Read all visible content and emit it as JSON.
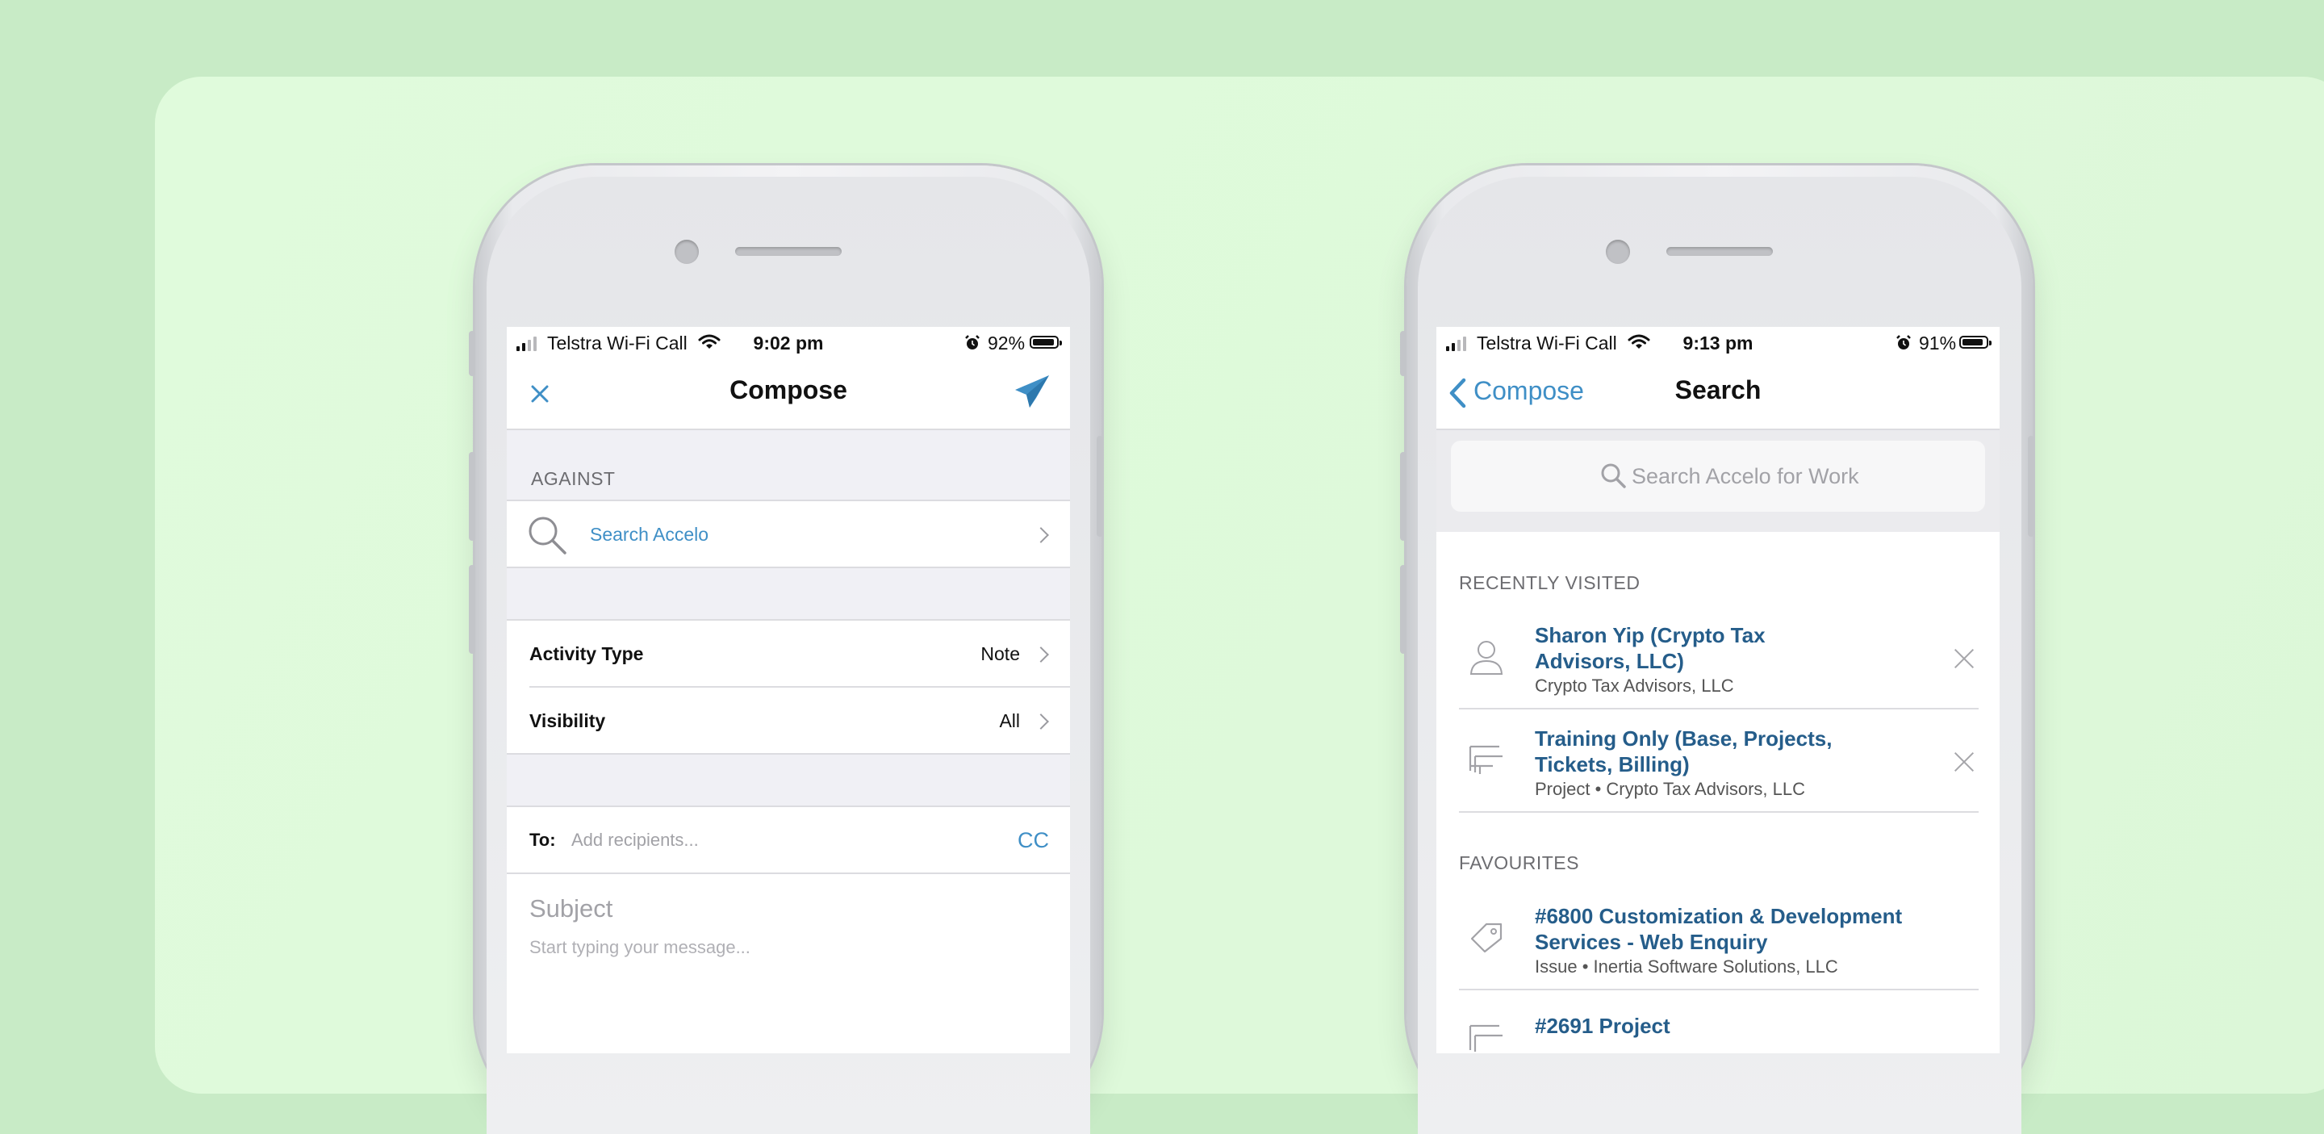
{
  "left_phone": {
    "status": {
      "carrier": "Telstra Wi-Fi Call",
      "time": "9:02 pm",
      "battery": "92%",
      "battery_level": 0.92
    },
    "nav": {
      "title": "Compose",
      "close_icon": "close-icon",
      "send_icon": "send-icon"
    },
    "against": {
      "label": "AGAINST",
      "search_text": "Search Accelo"
    },
    "activity_type": {
      "label": "Activity Type",
      "value": "Note"
    },
    "visibility": {
      "label": "Visibility",
      "value": "All"
    },
    "to": {
      "label": "To:",
      "placeholder": "Add recipients...",
      "cc": "CC"
    },
    "subject": {
      "placeholder": "Subject"
    },
    "message": {
      "placeholder": "Start typing your message..."
    }
  },
  "right_phone": {
    "status": {
      "carrier": "Telstra Wi-Fi Call",
      "time": "9:13 pm",
      "battery": "91%",
      "battery_level": 0.91
    },
    "nav": {
      "back_label": "Compose",
      "title": "Search"
    },
    "search": {
      "placeholder": "Search Accelo for Work"
    },
    "recent": {
      "label": "RECENTLY VISITED",
      "items": [
        {
          "title_line1": "Sharon Yip (Crypto Tax",
          "title_line2": "Advisors, LLC)",
          "sub": "Crypto Tax Advisors, LLC",
          "icon": "person-icon"
        },
        {
          "title_line1": "Training Only (Base, Projects,",
          "title_line2": "Tickets, Billing)",
          "sub": "Project • Crypto Tax Advisors, LLC",
          "icon": "project-icon"
        }
      ]
    },
    "favourites": {
      "label": "FAVOURITES",
      "items": [
        {
          "title_line1": "#6800 Customization & Development",
          "title_line2": "Services - Web Enquiry",
          "sub": "Issue • Inertia Software Solutions, LLC",
          "icon": "tag-icon"
        },
        {
          "title_line1": "#2691 Project",
          "icon": "project-icon"
        }
      ]
    }
  },
  "colors": {
    "accent": "#3f8fc6",
    "link_title": "#255d8a",
    "bg": "#c8ebc6",
    "card": "#e0fbdc"
  }
}
